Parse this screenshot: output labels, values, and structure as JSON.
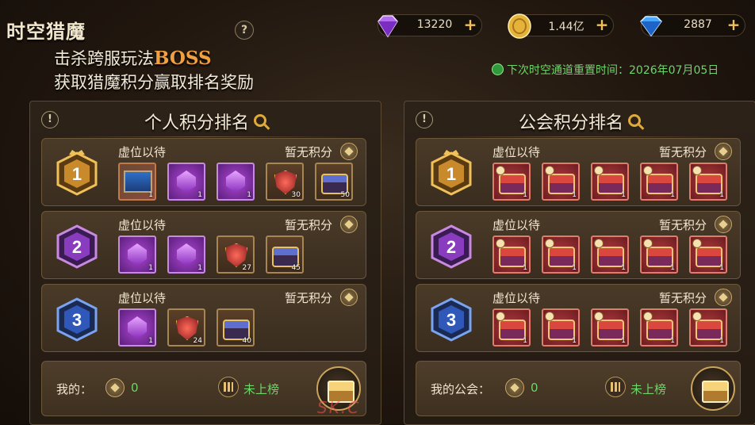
{
  "header": {
    "title": "时空猎魔",
    "help_label": "?",
    "subtitle_prefix": "击杀跨服玩法",
    "subtitle_highlight": "BOSS",
    "subtitle_line2": "获取猎魔积分赢取排名奖励"
  },
  "currencies": [
    {
      "name": "purple-gem",
      "value": "13220",
      "plus": "+"
    },
    {
      "name": "gold-coin",
      "value": "1.44亿",
      "plus": "+"
    },
    {
      "name": "blue-diamond",
      "value": "2887",
      "plus": "+"
    }
  ],
  "reset_text": "下次时空通道重置时间：2026年07月05日",
  "personal": {
    "info_label": "!",
    "title": "个人积分排名",
    "rows": [
      {
        "rank": "1",
        "placeholder": "虚位以待",
        "score": "暂无积分",
        "items": [
          {
            "type": "banner",
            "qty": "1"
          },
          {
            "type": "purple-gem",
            "qty": "1"
          },
          {
            "type": "purple-gem",
            "qty": "1"
          },
          {
            "type": "red-badge",
            "qty": "30"
          },
          {
            "type": "chest",
            "qty": "50"
          }
        ]
      },
      {
        "rank": "2",
        "placeholder": "虚位以待",
        "score": "暂无积分",
        "items": [
          {
            "type": "purple-gem",
            "qty": "1"
          },
          {
            "type": "purple-gem",
            "qty": "1"
          },
          {
            "type": "red-badge",
            "qty": "27"
          },
          {
            "type": "chest",
            "qty": "45"
          }
        ]
      },
      {
        "rank": "3",
        "placeholder": "虚位以待",
        "score": "暂无积分",
        "items": [
          {
            "type": "purple-gem",
            "qty": "1"
          },
          {
            "type": "red-badge",
            "qty": "24"
          },
          {
            "type": "chest",
            "qty": "40"
          }
        ]
      }
    ],
    "my_label": "我的：",
    "my_score": "0",
    "my_status": "未上榜"
  },
  "guild": {
    "info_label": "!",
    "title": "公会积分排名",
    "rows": [
      {
        "rank": "1",
        "placeholder": "虚位以待",
        "score": "暂无积分",
        "items": [
          {
            "qty": "1"
          },
          {
            "qty": "1"
          },
          {
            "qty": "1"
          },
          {
            "qty": "1"
          },
          {
            "qty": "1"
          }
        ]
      },
      {
        "rank": "2",
        "placeholder": "虚位以待",
        "score": "暂无积分",
        "items": [
          {
            "qty": "1"
          },
          {
            "qty": "1"
          },
          {
            "qty": "1"
          },
          {
            "qty": "1"
          },
          {
            "qty": "1"
          }
        ]
      },
      {
        "rank": "3",
        "placeholder": "虚位以待",
        "score": "暂无积分",
        "items": [
          {
            "qty": "1"
          },
          {
            "qty": "1"
          },
          {
            "qty": "1"
          },
          {
            "qty": "1"
          },
          {
            "qty": "1"
          }
        ]
      }
    ],
    "my_label": "我的公会：",
    "my_score": "0",
    "my_status": "未上榜"
  },
  "watermark": "SK.C",
  "colors": {
    "rank1": "#c98a2c",
    "rank2": "#8a3cbf",
    "rank3": "#2f58b8",
    "status_green": "#6fd46a",
    "accent_gold": "#e0aa3a"
  }
}
